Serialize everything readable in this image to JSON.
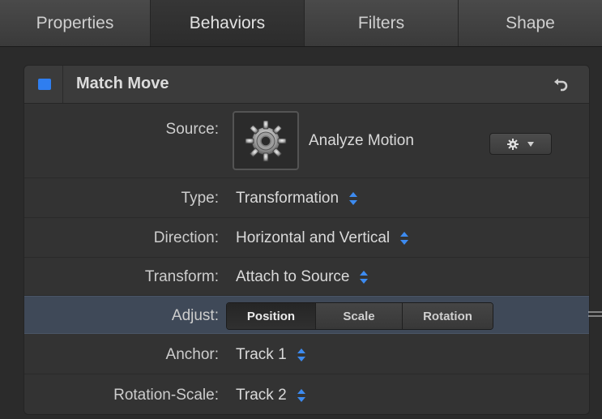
{
  "tabs": [
    {
      "label": "Properties",
      "active": false
    },
    {
      "label": "Behaviors",
      "active": true
    },
    {
      "label": "Filters",
      "active": false
    },
    {
      "label": "Shape",
      "active": false
    }
  ],
  "behavior": {
    "title": "Match Move",
    "enabled": true,
    "checkbox_color": "#2f7ef0",
    "reset_icon": "reset-arrow-icon"
  },
  "source": {
    "label": "Source:",
    "thumbnail_icon": "gear-thumbnail-icon",
    "button_label": "Analyze Motion",
    "action_menu_icon": "gear-icon"
  },
  "params": {
    "type": {
      "label": "Type:",
      "value": "Transformation"
    },
    "direction": {
      "label": "Direction:",
      "value": "Horizontal and Vertical"
    },
    "transform": {
      "label": "Transform:",
      "value": "Attach to Source"
    },
    "adjust": {
      "label": "Adjust:",
      "options": [
        "Position",
        "Scale",
        "Rotation"
      ],
      "selected": "Position"
    },
    "anchor": {
      "label": "Anchor:",
      "value": "Track 1"
    },
    "rotation_scale": {
      "label": "Rotation-Scale:",
      "value": "Track 2"
    }
  },
  "colors": {
    "accent": "#2f7ef0",
    "popup_arrows": "#3d8bf0",
    "selected_row": "#3f4958"
  }
}
